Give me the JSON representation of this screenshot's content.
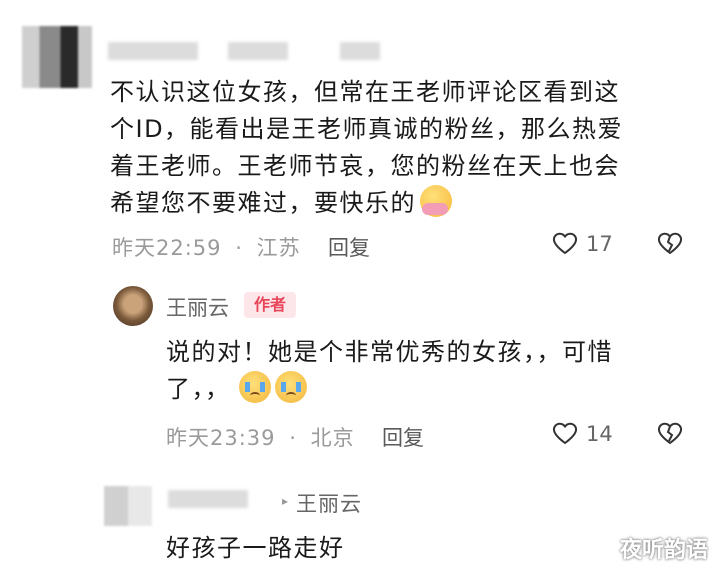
{
  "comment1": {
    "lines": [
      "不认识这位女孩，但常在王老师评论区看到这",
      "个ID，能看出是王老师真诚的粉丝，那么热爱",
      "着王老师。王老师节哀，您的粉丝在天上也会",
      "希望您不要难过，要快乐的"
    ],
    "time": "昨天22:59",
    "location": "江苏",
    "reply": "回复",
    "likes": "17"
  },
  "reply1": {
    "author": "王丽云",
    "badge": "作者",
    "lines": [
      "说的对！她是个非常优秀的女孩，，可惜",
      "了，，"
    ],
    "time": "昨天23:39",
    "location": "北京",
    "reply": "回复",
    "likes": "14"
  },
  "reply2": {
    "reply_to": "王丽云",
    "text": "好孩子一路走好"
  },
  "watermark": "夜听韵语",
  "colors": {
    "badge_bg": "#fde6e9",
    "badge_text": "#e8445a",
    "meta": "#9a9a9a"
  }
}
